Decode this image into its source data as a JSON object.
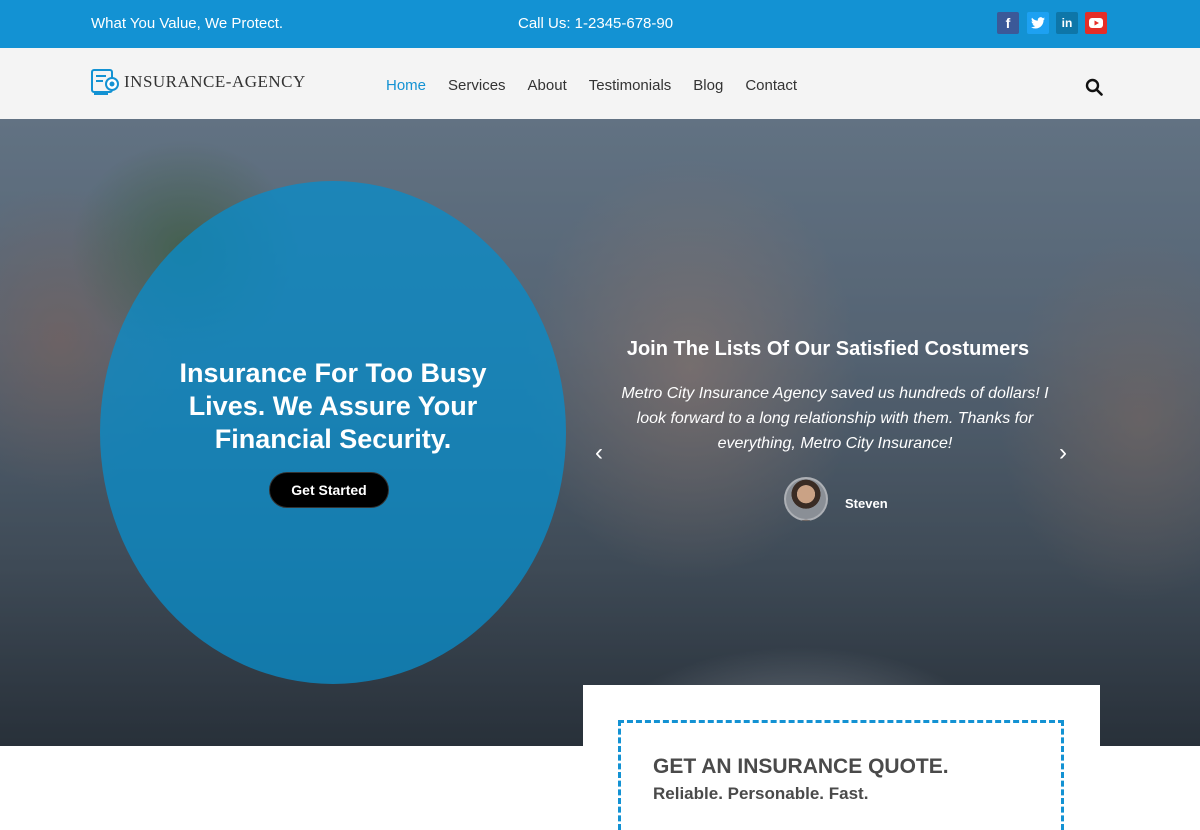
{
  "topbar": {
    "tagline": "What You Value, We Protect.",
    "phone": "Call Us: 1-2345-678-90",
    "social": [
      {
        "name": "facebook-icon",
        "glyph": "f",
        "color": "#3b5998"
      },
      {
        "name": "twitter-icon",
        "glyph": "t",
        "color": "#1da1f2"
      },
      {
        "name": "linkedin-icon",
        "glyph": "in",
        "color": "#0e76a8"
      },
      {
        "name": "youtube-icon",
        "glyph": "▶",
        "color": "#e52d27"
      }
    ]
  },
  "header": {
    "logo_text": "INSURANCE-AGENCY",
    "nav": [
      {
        "label": "Home",
        "active": true
      },
      {
        "label": "Services"
      },
      {
        "label": "About"
      },
      {
        "label": "Testimonials"
      },
      {
        "label": "Blog"
      },
      {
        "label": "Contact"
      }
    ]
  },
  "hero": {
    "title": "Insurance For Too Busy Lives. We Assure Your Financial Security.",
    "cta_label": "Get Started"
  },
  "testimonial": {
    "title": "Join The Lists Of Our Satisfied Costumers",
    "quote": "Metro City Insurance Agency saved us hundreds of dollars! I look forward to a long relationship with them. Thanks for everything, Metro City Insurance!",
    "author": "Steven",
    "prev_arrow": "‹",
    "next_arrow": "›"
  },
  "quote_form": {
    "title": "GET AN INSURANCE QUOTE.",
    "subtitle": "Reliable. Personable. Fast."
  },
  "colors": {
    "brand": "#1392d3",
    "nav_bg": "#f4f4f4",
    "cta_bg": "#000000"
  }
}
